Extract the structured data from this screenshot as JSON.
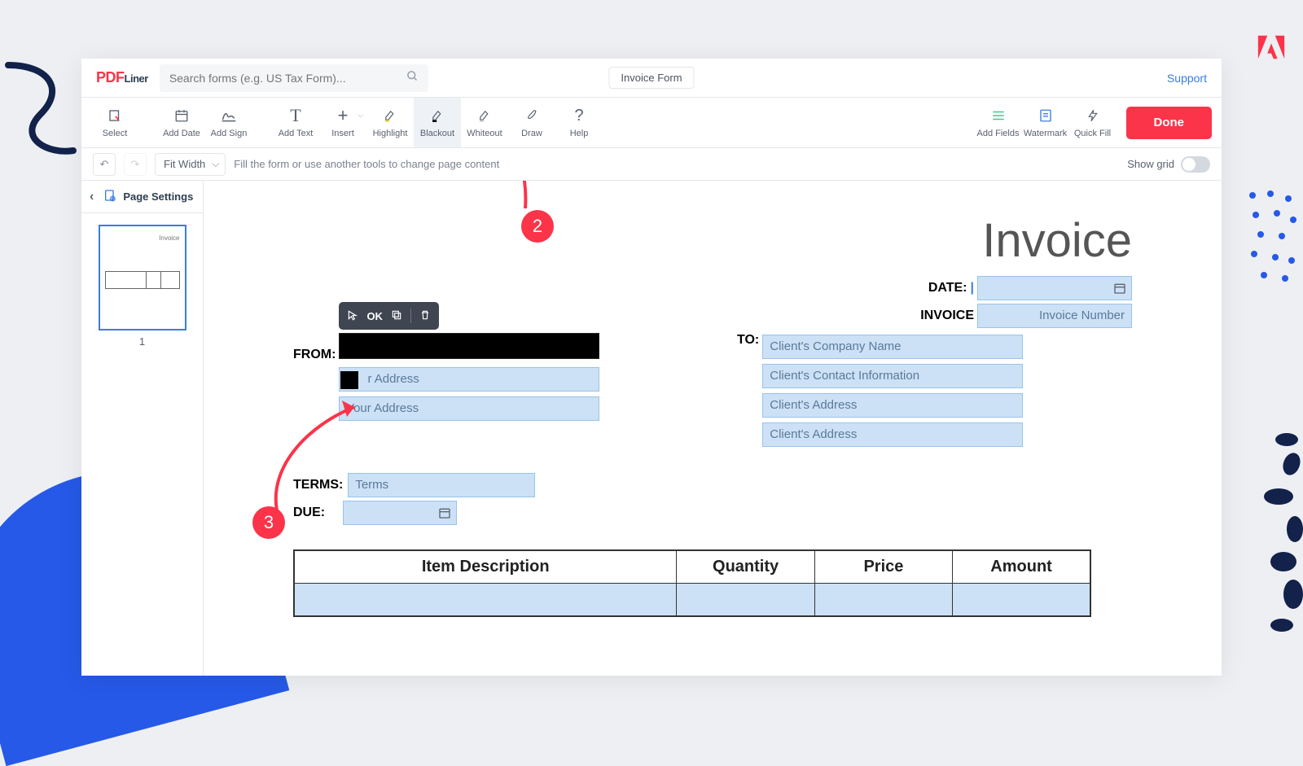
{
  "brand": {
    "pdf": "PDF",
    "liner": "Liner"
  },
  "search": {
    "placeholder": "Search forms (e.g. US Tax Form)..."
  },
  "file_name": "Invoice Form",
  "support": "Support",
  "toolbar": {
    "select": "Select",
    "add_date": "Add Date",
    "add_sign": "Add Sign",
    "add_text": "Add Text",
    "insert": "Insert",
    "highlight": "Highlight",
    "blackout": "Blackout",
    "whiteout": "Whiteout",
    "draw": "Draw",
    "help": "Help",
    "add_fields": "Add Fields",
    "watermark": "Watermark",
    "quick_fill": "Quick Fill"
  },
  "done": "Done",
  "zoom": "Fit Width",
  "hint": "Fill the form or use another tools to change page content",
  "show_grid": "Show grid",
  "sidebar": {
    "page_settings": "Page Settings",
    "page_no": "1"
  },
  "doc": {
    "title": "Invoice",
    "date_label": "DATE:",
    "invoice_label": "INVOICE",
    "invoice_number_ph": "Invoice Number",
    "from_label": "FROM:",
    "from_address_partial": "r Address",
    "from_address2": "Your Address",
    "to_label": "TO:",
    "to_company": "Client's Company Name",
    "to_contact": "Client's Contact Information",
    "to_addr1": "Client's Address",
    "to_addr2": "Client's Address",
    "terms_label": "TERMS:",
    "terms_ph": "Terms",
    "due_label": "DUE:",
    "table": {
      "c1": "Item Description",
      "c2": "Quantity",
      "c3": "Price",
      "c4": "Amount"
    }
  },
  "editbar": {
    "ok": "OK"
  },
  "annotations": {
    "b2": "2",
    "b3": "3"
  }
}
